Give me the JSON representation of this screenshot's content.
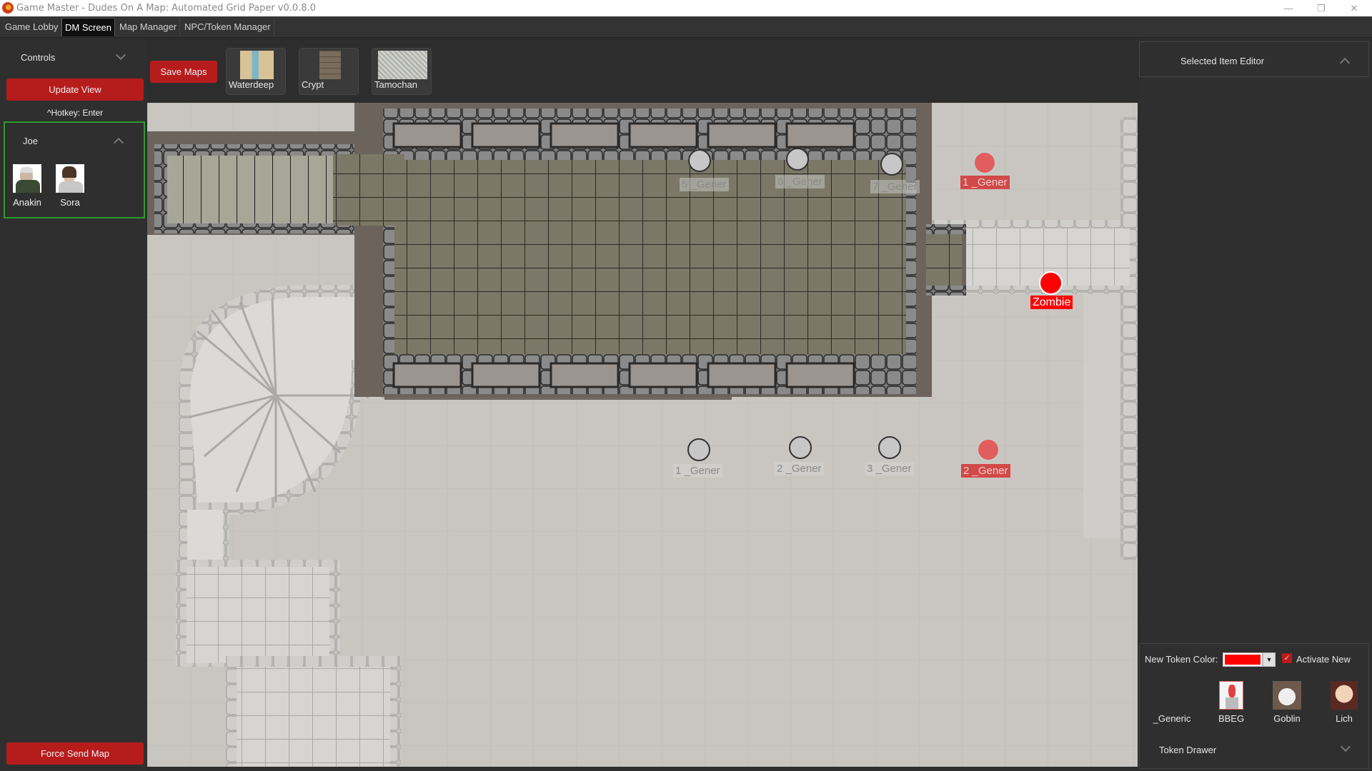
{
  "window": {
    "title": "Game Master - Dudes On A Map: Automated Grid Paper v0.0.8.0",
    "controls": {
      "minimize": "—",
      "restore": "❐",
      "close": "✕"
    }
  },
  "tabs": [
    {
      "label": "Game Lobby",
      "active": false
    },
    {
      "label": "DM Screen",
      "active": true
    },
    {
      "label": "Map Manager",
      "active": false
    },
    {
      "label": "NPC/Token Manager",
      "active": false
    }
  ],
  "left_panel": {
    "controls_label": "Controls",
    "update_view_label": "Update View",
    "hotkey_hint": "^Hotkey: Enter",
    "player": {
      "name": "Joe",
      "tokens": [
        {
          "label": "Anakin",
          "icon": "character-portrait-icon"
        },
        {
          "label": "Sora",
          "icon": "character-portrait-icon"
        }
      ]
    },
    "force_send_label": "Force Send Map"
  },
  "toolbar": {
    "save_maps_label": "Save Maps",
    "maps": [
      {
        "label": "Waterdeep",
        "icon": "map-thumbnail-icon"
      },
      {
        "label": "Crypt",
        "icon": "map-thumbnail-icon"
      },
      {
        "label": "Tamochan",
        "icon": "map-thumbnail-icon"
      }
    ]
  },
  "map": {
    "tokens": [
      {
        "label": "5 _Gener",
        "active": false
      },
      {
        "label": "6 _Gener",
        "active": false
      },
      {
        "label": "7 _Gener",
        "active": false
      },
      {
        "label": "1 _Gener",
        "active": true,
        "row": "top"
      },
      {
        "label": "1 _Gener",
        "active": false,
        "row": "bottom"
      },
      {
        "label": "2 _Gener",
        "active": false
      },
      {
        "label": "3 _Gener",
        "active": false
      },
      {
        "label": "2 _Gener",
        "active": true
      },
      {
        "label": "Zombie",
        "active": true,
        "selected": true
      }
    ],
    "colors": {
      "active_token": "#ff0000",
      "inactive_token": "#d9d9d9",
      "grid_paper": "#c9c6c1"
    }
  },
  "right_panel": {
    "editor_label": "Selected Item Editor",
    "new_token_color_label": "New Token Color:",
    "new_token_color": "#ff0000",
    "activate_new_label": "Activate New",
    "activate_new_checked": true,
    "token_drawer_items": [
      {
        "label": "_Generic",
        "icon": ""
      },
      {
        "label": "BBEG",
        "icon": "portrait-icon"
      },
      {
        "label": "Goblin",
        "icon": "portrait-icon"
      },
      {
        "label": "Lich",
        "icon": "portrait-icon"
      }
    ],
    "token_drawer_label": "Token Drawer"
  },
  "theme": {
    "accent_red": "#b71c1c",
    "player_border": "#2e9b2e",
    "panel_bg": "#2f2f2f"
  }
}
